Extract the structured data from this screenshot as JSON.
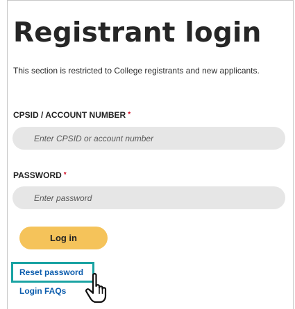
{
  "page": {
    "title": "Registrant login",
    "intro": "This section is restricted to College registrants and new applicants."
  },
  "form": {
    "cpsid": {
      "label": "CPSID / ACCOUNT NUMBER",
      "required_mark": "*",
      "placeholder": "Enter CPSID or account number"
    },
    "password": {
      "label": "PASSWORD",
      "required_mark": "*",
      "placeholder": "Enter password"
    },
    "submit_label": "Log in"
  },
  "links": {
    "reset_password": "Reset password",
    "login_faqs": "Login FAQs"
  },
  "colors": {
    "button": "#f5c35a",
    "field_bg": "#e6e6e6",
    "link": "#0b5cad",
    "highlight": "#1aa3a3",
    "required": "#d0021b"
  },
  "icons": {
    "cursor": "hand-pointer-icon"
  }
}
